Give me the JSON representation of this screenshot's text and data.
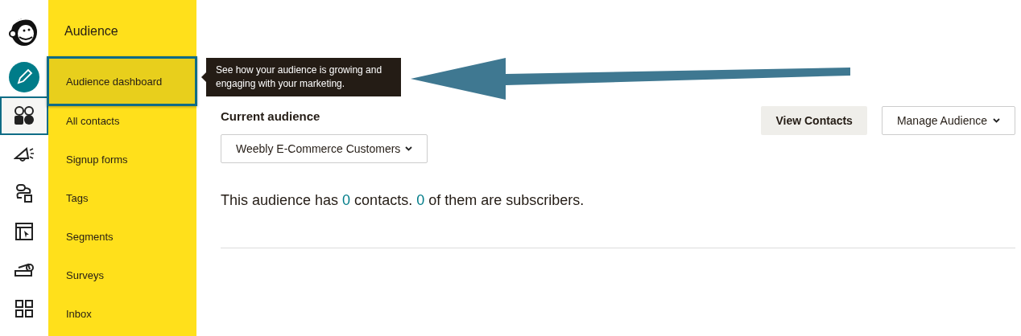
{
  "rail": [
    {
      "kind": "logo",
      "selected": false
    },
    {
      "kind": "create",
      "selected": false
    },
    {
      "kind": "audience",
      "selected": true
    },
    {
      "kind": "campaigns",
      "selected": false
    },
    {
      "kind": "automations",
      "selected": false
    },
    {
      "kind": "website",
      "selected": false
    },
    {
      "kind": "content",
      "selected": false
    },
    {
      "kind": "integrations",
      "selected": false
    }
  ],
  "sidebar": {
    "title": "Audience",
    "items": [
      {
        "label": "Audience dashboard",
        "selected": true
      },
      {
        "label": "All contacts",
        "selected": false
      },
      {
        "label": "Signup forms",
        "selected": false
      },
      {
        "label": "Tags",
        "selected": false
      },
      {
        "label": "Segments",
        "selected": false
      },
      {
        "label": "Surveys",
        "selected": false
      },
      {
        "label": "Inbox",
        "selected": false
      }
    ]
  },
  "tooltip": "See how your audience is growing and engaging with your marketing.",
  "current_audience": {
    "label": "Current audience",
    "value": "Weebly E-Commerce Customers"
  },
  "buttons": [
    {
      "label": "View Contacts",
      "kind": "secondary"
    },
    {
      "label": "Manage Audience",
      "kind": "menu"
    }
  ],
  "summary": {
    "prefix": "This audience has",
    "contacts": "0",
    "middle": "contacts.",
    "subscribers": "0",
    "suffix": "of them are subscribers."
  }
}
